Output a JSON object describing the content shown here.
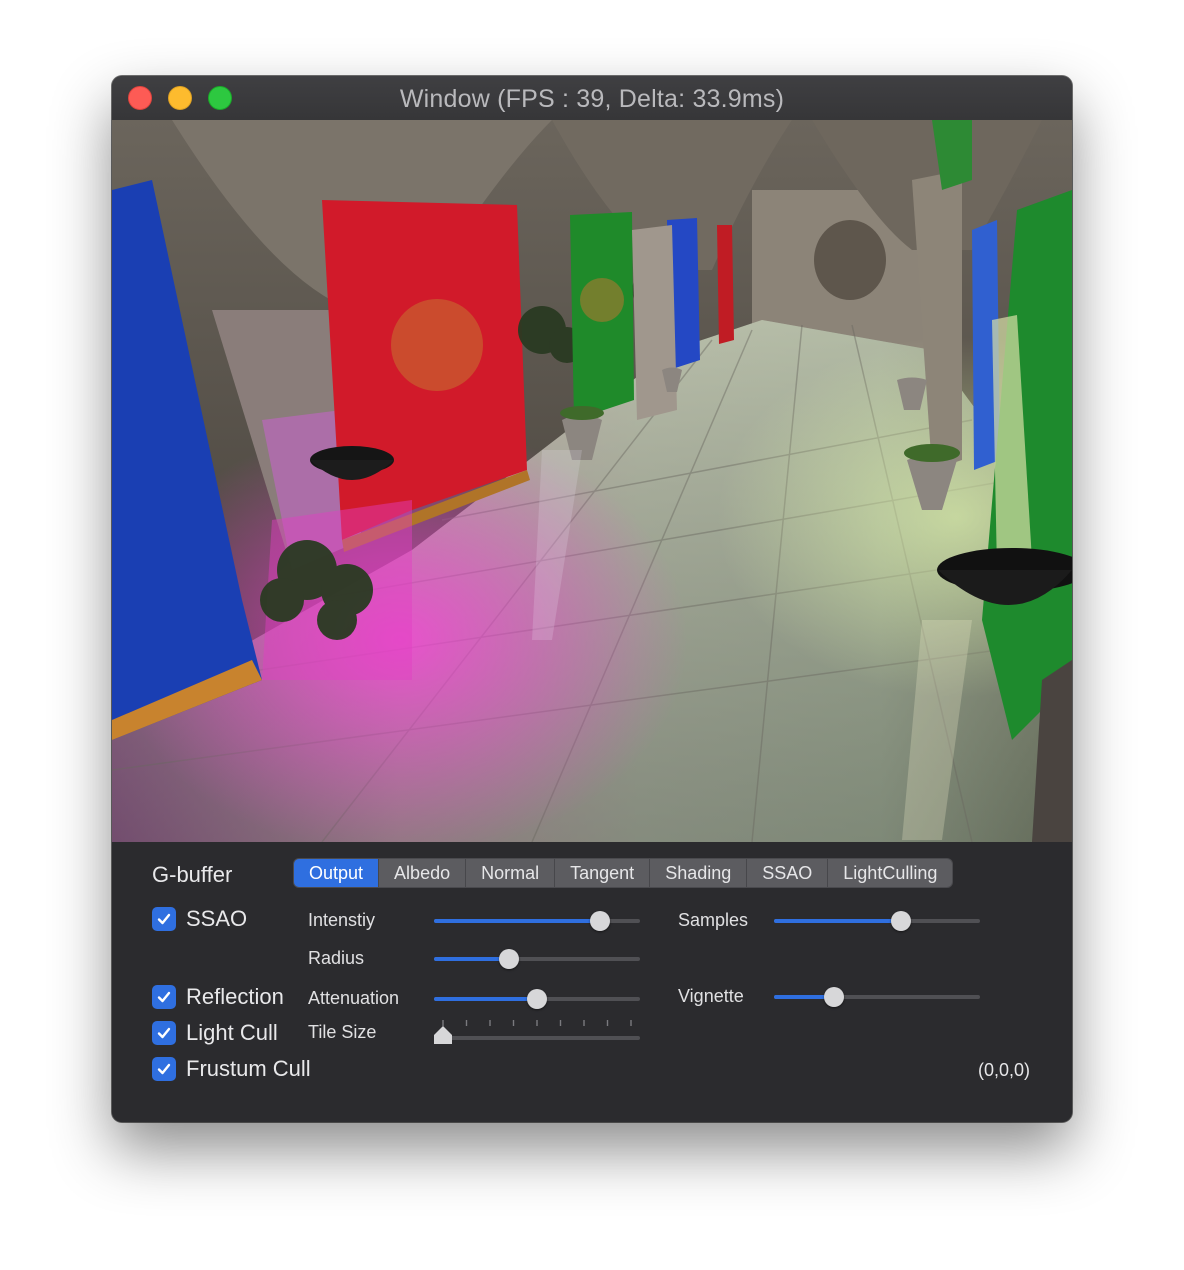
{
  "window": {
    "title": "Window (FPS : 39, Delta: 33.9ms)"
  },
  "controls": {
    "gbuffer_label": "G-buffer",
    "tabs": [
      {
        "label": "Output",
        "active": true
      },
      {
        "label": "Albedo",
        "active": false
      },
      {
        "label": "Normal",
        "active": false
      },
      {
        "label": "Tangent",
        "active": false
      },
      {
        "label": "Shading",
        "active": false
      },
      {
        "label": "SSAO",
        "active": false
      },
      {
        "label": "LightCulling",
        "active": false
      }
    ],
    "checkboxes": {
      "ssao": {
        "label": "SSAO",
        "checked": true
      },
      "reflection": {
        "label": "Reflection",
        "checked": true
      },
      "light_cull": {
        "label": "Light Cull",
        "checked": true
      },
      "frustum_cull": {
        "label": "Frustum Cull",
        "checked": true
      }
    },
    "sliders": {
      "intensity": {
        "label": "Intenstiy",
        "value": 0.84
      },
      "samples": {
        "label": "Samples",
        "value": 0.63
      },
      "radius": {
        "label": "Radius",
        "value": 0.35
      },
      "attenuation": {
        "label": "Attenuation",
        "value": 0.5
      },
      "vignette": {
        "label": "Vignette",
        "value": 0.27
      },
      "tile_size": {
        "label": "Tile Size",
        "value": 0.0,
        "ticks": 9
      }
    },
    "coords": "(0,0,0)"
  },
  "colors": {
    "accent": "#2f6fe0",
    "panel": "#2b2b2e"
  }
}
